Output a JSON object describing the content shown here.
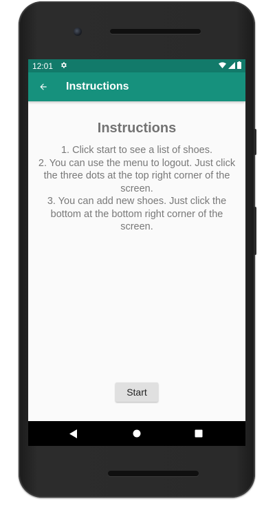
{
  "status_bar": {
    "time": "12:01",
    "settings_icon": "gear-icon",
    "wifi_icon": "wifi-icon",
    "signal_icon": "signal-icon",
    "battery_icon": "battery-icon",
    "color": "#127a6a"
  },
  "app_bar": {
    "back_icon": "arrow-back-icon",
    "title": "Instructions",
    "color": "#16917d"
  },
  "main": {
    "heading": "Instructions",
    "lines": [
      "1. Click start to see a list of shoes.",
      "2. You can use the menu to logout. Just click the three dots at the top right corner of the screen.",
      "3. You can add new shoes. Just click the bottom at the bottom right corner of the screen."
    ],
    "start_label": "Start"
  },
  "nav_bar": {
    "back_icon": "triangle-back-icon",
    "home_icon": "circle-home-icon",
    "recents_icon": "square-recents-icon"
  }
}
